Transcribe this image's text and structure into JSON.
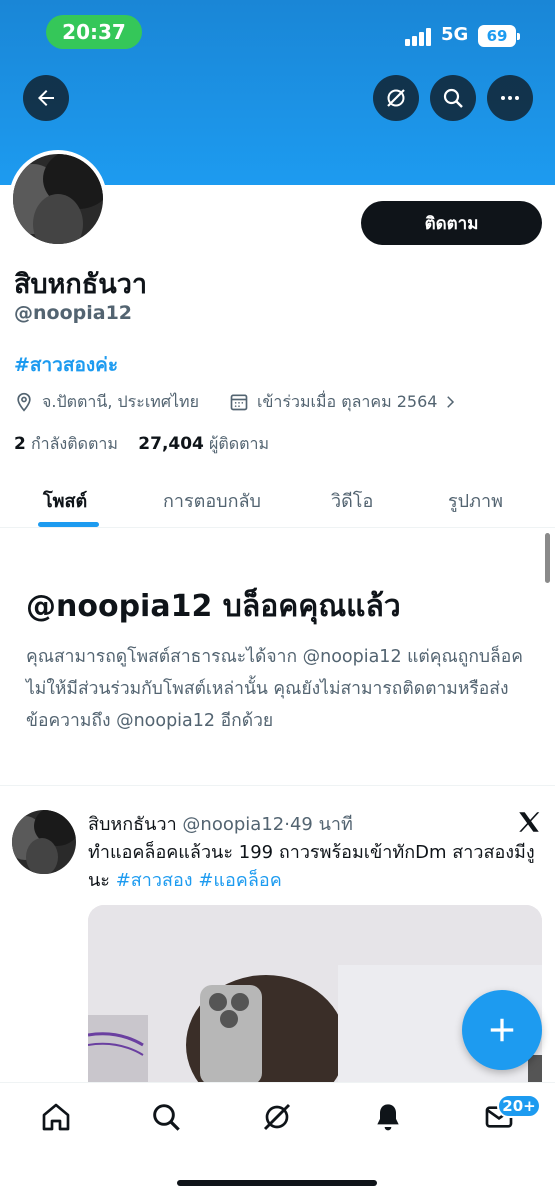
{
  "status_bar": {
    "time": "20:37",
    "network": "5G",
    "battery": "69"
  },
  "profile": {
    "follow_label": "ติดตาม",
    "display_name": "สิบหกธันวา",
    "handle": "@noopia12",
    "bio": "#สาวสองค่ะ",
    "location": "จ.ปัตตานี, ประเทศไทย",
    "joined": "เข้าร่วมเมื่อ ตุลาคม 2564",
    "following_count": "2",
    "following_label": "กำลังติดตาม",
    "followers_count": "27,404",
    "followers_label": "ผู้ติดตาม"
  },
  "tabs": [
    {
      "label": "โพสต์",
      "active": true
    },
    {
      "label": "การตอบกลับ",
      "active": false
    },
    {
      "label": "วิดีโอ",
      "active": false
    },
    {
      "label": "รูปภาพ",
      "active": false
    }
  ],
  "blocked": {
    "title": "@noopia12 บล็อคคุณแล้ว",
    "message": "คุณสามารถดูโพสต์สาธารณะได้จาก @noopia12 แต่คุณถูกบล็อคไม่ให้มีส่วนร่วมกับโพสต์เหล่านั้น คุณยังไม่สามารถติดตามหรือส่งข้อความถึง @noopia12 อีกด้วย"
  },
  "post": {
    "author": "สิบหกธันวา",
    "handle": "@noopia12",
    "separator": "·",
    "time": "49 นาที",
    "text": "ทำแอคล็อคแล้วนะ 199 ถาวรพร้อมเข้าทักDm สาวสองมีงูนะ ",
    "tag1": "#สาวสอง",
    "tag2": "#แอคล็อค"
  },
  "notifications_badge": "20+",
  "colors": {
    "accent": "#1d9bf0",
    "text": "#0f1419",
    "secondary": "#536471",
    "status_pill": "#35c759"
  },
  "icons": [
    "back-arrow-icon",
    "grok-icon",
    "search-icon",
    "more-icon",
    "location-icon",
    "calendar-icon",
    "chevron-right-icon",
    "x-logo-icon",
    "plus-icon",
    "home-icon",
    "notifications-bell-icon",
    "messages-icon"
  ]
}
